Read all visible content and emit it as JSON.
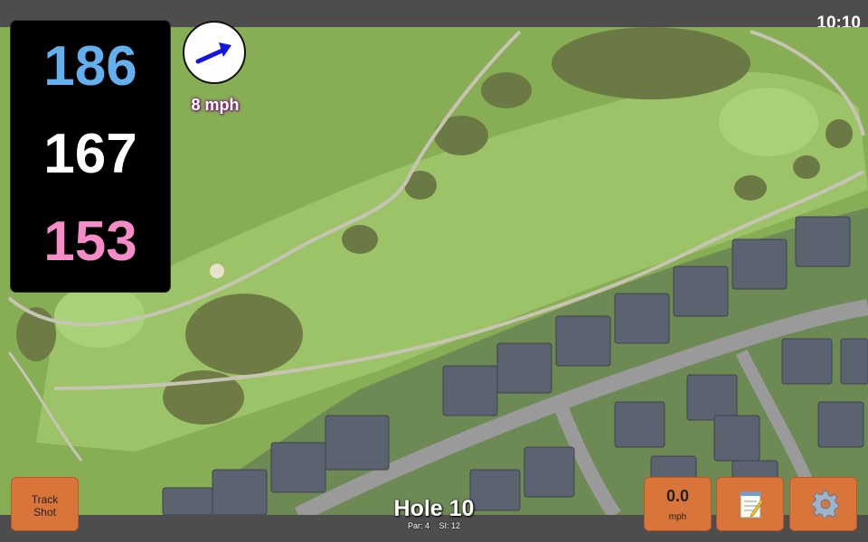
{
  "status": {
    "time": "10:10"
  },
  "distances": {
    "back": "186",
    "middle": "167",
    "front": "153"
  },
  "wind": {
    "speed_label": "8 mph",
    "arrow_icon": "arrow-right-icon"
  },
  "buttons": {
    "track_shot_line1": "Track",
    "track_shot_line2": "Shot",
    "speed_value": "0.0",
    "speed_unit": "mph",
    "notes_icon": "notepad-icon",
    "settings_icon": "gear-icon"
  },
  "hole": {
    "title": "Hole 10",
    "par": "Par: 4",
    "si": "SI: 12"
  },
  "colors": {
    "back_distance": "#64b0ef",
    "middle_distance": "#ffffff",
    "front_distance": "#f58bc7",
    "button": "#d9743a",
    "wind_arrow": "#1515e0"
  }
}
